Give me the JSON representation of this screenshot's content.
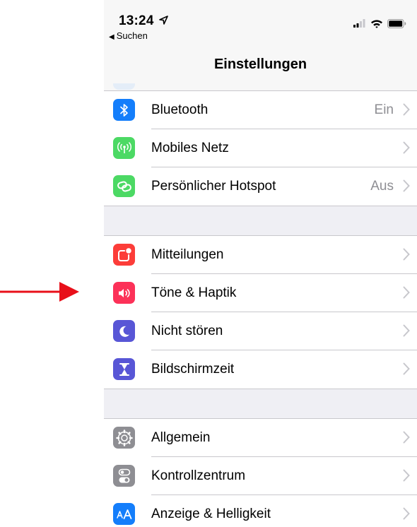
{
  "status_bar": {
    "time": "13:24",
    "back_label": "Suchen",
    "icons": [
      "location-arrow-icon",
      "signal-icon",
      "wifi-icon",
      "battery-icon"
    ]
  },
  "navbar": {
    "title": "Einstellungen"
  },
  "groups": [
    {
      "rows": [
        {
          "label": "Bluetooth",
          "value": "Ein",
          "icon": "bluetooth-icon",
          "color": "#147efb"
        },
        {
          "label": "Mobiles Netz",
          "value": "",
          "icon": "antenna-icon",
          "color": "#4cd964"
        },
        {
          "label": "Persönlicher Hotspot",
          "value": "Aus",
          "icon": "hotspot-link-icon",
          "color": "#4cd964"
        }
      ]
    },
    {
      "rows": [
        {
          "label": "Mitteilungen",
          "value": "",
          "icon": "notifications-icon",
          "color": "#fc3d39"
        },
        {
          "label": "Töne & Haptik",
          "value": "",
          "icon": "speaker-icon",
          "color": "#fc3158"
        },
        {
          "label": "Nicht stören",
          "value": "",
          "icon": "moon-icon",
          "color": "#5856d6"
        },
        {
          "label": "Bildschirmzeit",
          "value": "",
          "icon": "hourglass-icon",
          "color": "#5856d6"
        }
      ]
    },
    {
      "rows": [
        {
          "label": "Allgemein",
          "value": "",
          "icon": "gear-icon",
          "color": "#8e8e93"
        },
        {
          "label": "Kontrollzentrum",
          "value": "",
          "icon": "toggles-icon",
          "color": "#8e8e93"
        },
        {
          "label": "Anzeige & Helligkeit",
          "value": "",
          "icon": "text-size-icon",
          "color": "#147efb"
        }
      ]
    }
  ],
  "annotation": {
    "icon": "red-arrow-icon",
    "color": "#e8101a",
    "points_to": "Töne & Haptik"
  }
}
